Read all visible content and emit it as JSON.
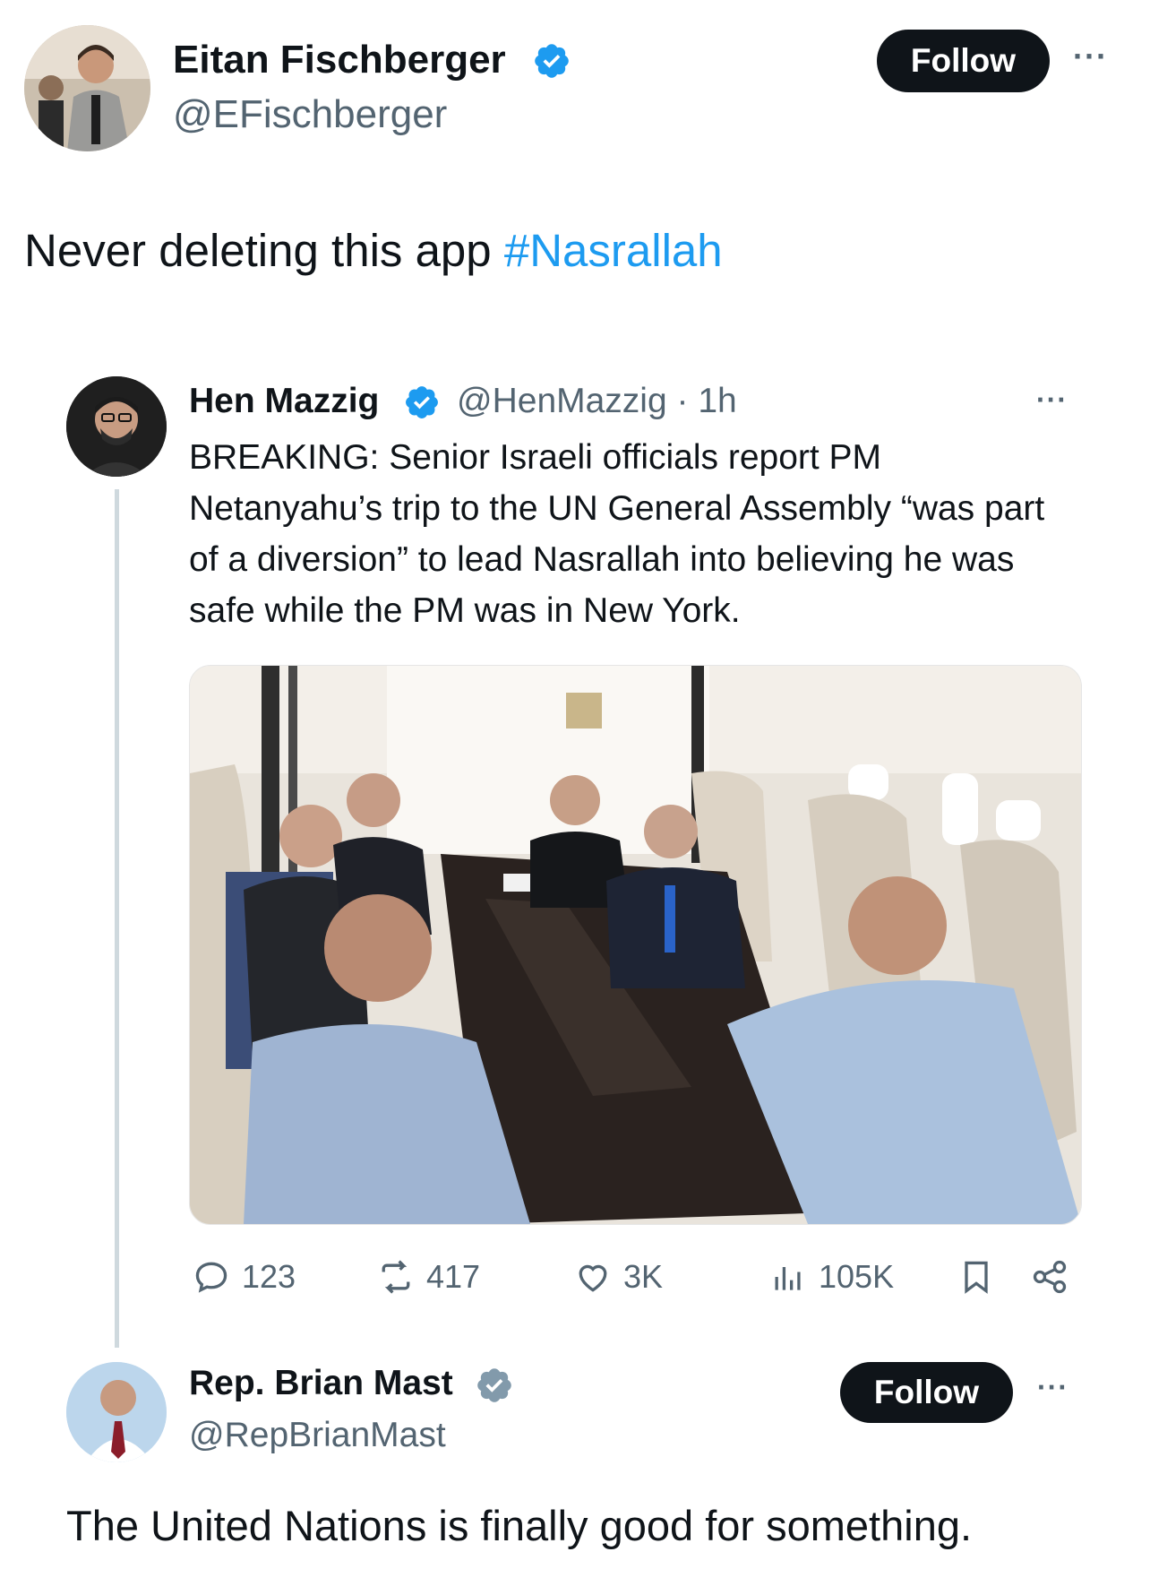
{
  "main_tweet": {
    "author_name": "Eitan Fischberger",
    "author_handle": "@EFischberger",
    "follow_label": "Follow",
    "more_label": "···",
    "text": "Never deleting this app ",
    "hashtag": "#Nasrallah"
  },
  "quoted_tweet": {
    "author_name": "Hen Mazzig",
    "author_handle_time": "@HenMazzig · 1h",
    "more_label": "···",
    "text": "BREAKING: Senior Israeli officials report PM Netanyahu’s trip to the UN General Assembly “was part of a diversion” to lead Nasrallah into believing he was safe while the PM was in New York.",
    "photo_icon": "photo-image",
    "stats": {
      "replies": "123",
      "reposts": "417",
      "likes": "3K",
      "views": "105K"
    }
  },
  "reply_tweet": {
    "author_name": "Rep. Brian Mast",
    "author_handle": "@RepBrianMast",
    "follow_label": "Follow",
    "more_label": "···",
    "text": "The United Nations is finally good for something."
  },
  "colors": {
    "accent": "#1d9bf0",
    "text": "#0f1419",
    "secondary_text": "#536471",
    "follow_button": "#0f1419",
    "verified_badge": "#1d9bf0",
    "government_badge": "#829aab"
  }
}
